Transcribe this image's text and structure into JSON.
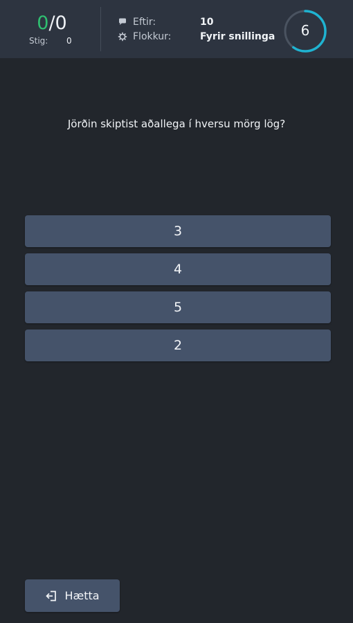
{
  "header": {
    "score_correct": "0",
    "score_sep": "/",
    "score_total": "0",
    "points_label": "Stig:",
    "points_value": "0",
    "remaining_label": "Eftir:",
    "remaining_value": "10",
    "category_label": "Flokkur:",
    "category_value": "Fyrir snillinga",
    "timer_value": "6",
    "timer_progress": 0.6,
    "colors": {
      "correct": "#2fbf71",
      "timer_ring": "#1fb3d1"
    }
  },
  "question": {
    "text": "Jörðin skiptist aðallega í hversu mörg lög?"
  },
  "answers": [
    "3",
    "4",
    "5",
    "2"
  ],
  "footer": {
    "quit_label": "Hætta"
  },
  "icons": [
    "chat-icon",
    "gear-icon",
    "exit-icon"
  ]
}
